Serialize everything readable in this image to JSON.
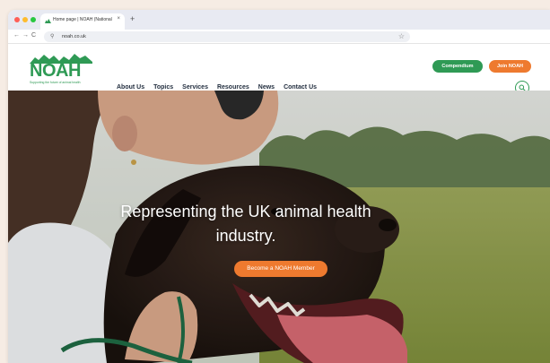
{
  "browser": {
    "tab_title": "Home page | NOAH (National",
    "tab_close": "×",
    "new_tab": "+",
    "url": "noah.co.uk",
    "nav_back": "←",
    "nav_forward": "→",
    "nav_reload": "C",
    "url_icon": "⚲",
    "bookmark": "☆"
  },
  "site": {
    "logo_text": "NOAH",
    "logo_tagline": "Supporting the future of animal health",
    "nav": [
      "About Us",
      "Topics",
      "Services",
      "Resources",
      "News",
      "Contact Us"
    ],
    "compendium_label": "Compendium",
    "join_label": "Join NOAH",
    "brand_green": "#2f9a55",
    "brand_orange": "#ee7a2f"
  },
  "hero": {
    "heading_line1": "Representing the UK animal health",
    "heading_line2": "industry.",
    "cta_label": "Become a NOAH Member"
  }
}
